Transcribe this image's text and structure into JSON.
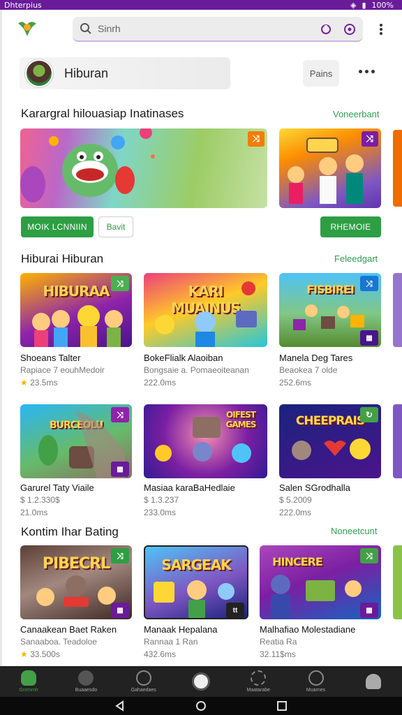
{
  "status": {
    "carrier": "Dhterpius",
    "battery": "100%"
  },
  "search": {
    "placeholder": "Sinrh"
  },
  "header": {
    "title": "Hiburan",
    "action": "Pains"
  },
  "sections": [
    {
      "title": "Karargral hilouasiap Inatinases",
      "link": "Voneerbant"
    },
    {
      "title": "Hiburai Hiburan",
      "link": "Feleedgart"
    },
    {
      "title": "Kontim Ihar Bating",
      "link": "Noneetcunt"
    }
  ],
  "featured": {
    "btn_primary": "MOIK LCNNIIN",
    "btn_secondary": "Bavit",
    "btn_side": "RHEMOIE"
  },
  "rows": [
    [
      {
        "art": "HIBURAA",
        "name": "Shoeans Talter",
        "sub": "Rapiace 7 eouhMedoir",
        "meta": "23.5ms",
        "star": true,
        "color": "#7b1fa2",
        "corner": "#4caf50"
      },
      {
        "art": "KARI MUAINUS",
        "name": "BokeFlialk Alaoiban",
        "sub": "Bongsaie a. Pomaeoiteanan",
        "meta": "222.0ms",
        "star": false,
        "color": "#f9a825",
        "corner": ""
      },
      {
        "art": "FISBIREI",
        "name": "Manela Deg Tares",
        "sub": "Beaokea 7 olde",
        "meta": "252.6ms",
        "star": false,
        "color": "#43a047",
        "corner": "#1976d2"
      }
    ],
    [
      {
        "art": "BURCEOLU",
        "name": "Garurel Taty Viaile",
        "sub": "$ 1.2.330$",
        "meta": "21.0ms",
        "star": false,
        "color": "#00897b",
        "corner": "#8e24aa"
      },
      {
        "art": "OIFEST GAMES",
        "name": "Masiaa karaBaHedlaie",
        "sub": "$ 1.3.237",
        "meta": "233.0ms",
        "star": false,
        "color": "#6a1b9a",
        "corner": ""
      },
      {
        "art": "CHEEPRAIS",
        "name": "Salen SGrodhalla",
        "sub": "$ 5.2009",
        "meta": "222.0ms",
        "star": false,
        "color": "#4a148c",
        "corner": "#43a047"
      }
    ],
    [
      {
        "art": "PIBECRL",
        "name": "Canaakean Baet Raken",
        "sub": "Sanaaboa. Teadoloe",
        "meta": "33.500s",
        "star": true,
        "color": "#5d4037",
        "corner": "#2e9e44"
      },
      {
        "art": "SARGEAK",
        "name": "Manaak Hepalana",
        "sub": "Rannaa 1 Ran",
        "meta": "432.6ms",
        "star": false,
        "color": "#1565c0",
        "corner": "#222"
      },
      {
        "art": "HINCERE",
        "name": "Malhafiao Molestadiane",
        "sub": "Reatia Ra",
        "meta": "32.11$ms",
        "star": false,
        "color": "#7b1fa2",
        "corner": "#43a047"
      }
    ]
  ],
  "nav": [
    {
      "label": "Gnrmrnlr",
      "icon": "home-icon",
      "active": true
    },
    {
      "label": "Buaaesdo",
      "icon": "chat-icon",
      "active": false
    },
    {
      "label": "Gahaedaes",
      "icon": "gamepad-icon",
      "active": false
    },
    {
      "label": "",
      "icon": "center-icon",
      "active": false
    },
    {
      "label": "Maatarabe",
      "icon": "gift-icon",
      "active": false
    },
    {
      "label": "Muarnes",
      "icon": "heart-icon",
      "active": false
    },
    {
      "label": "",
      "icon": "profile-icon",
      "active": false
    }
  ]
}
